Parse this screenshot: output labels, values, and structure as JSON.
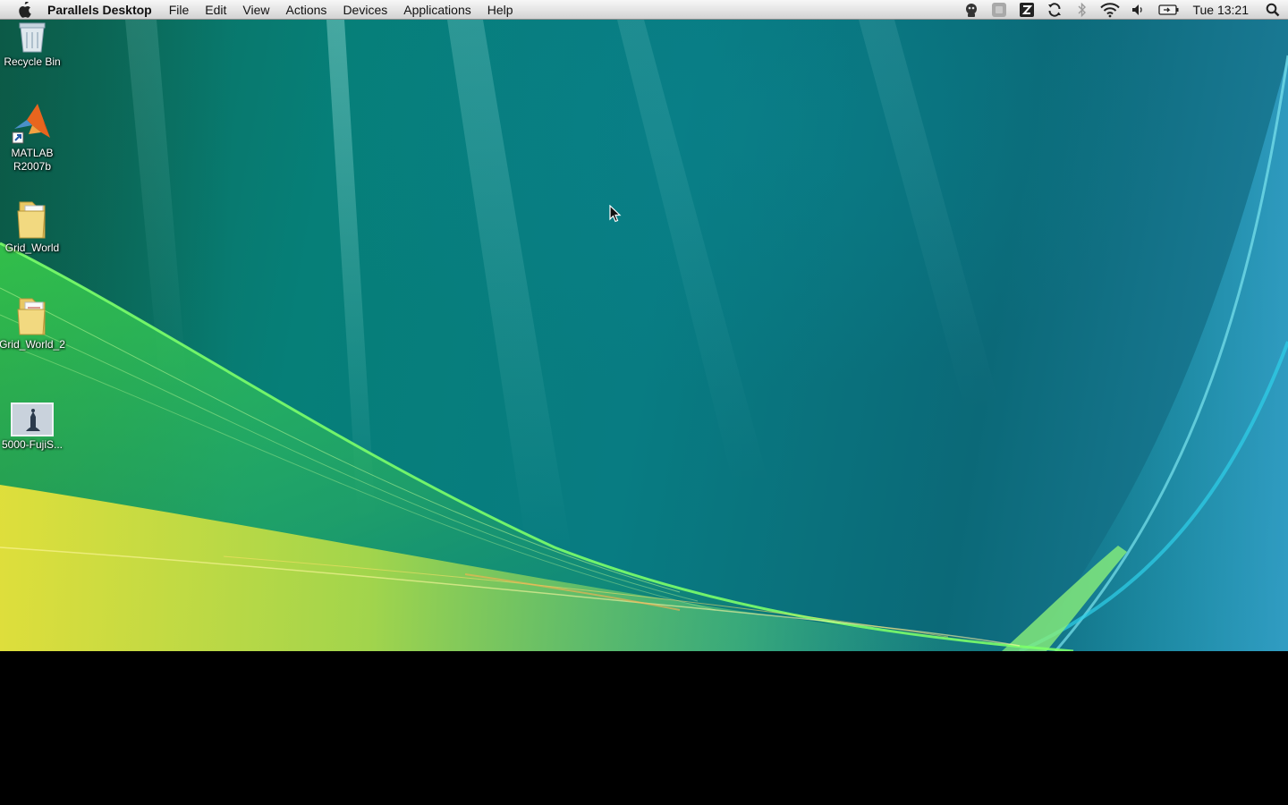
{
  "menubar": {
    "apple_icon": "apple-icon",
    "app_name": "Parallels Desktop",
    "menus": [
      "File",
      "Edit",
      "View",
      "Actions",
      "Devices",
      "Applications",
      "Help"
    ],
    "status_icons": [
      "parallels-icon",
      "coherence-icon",
      "app-switch-icon",
      "sync-icon",
      "bluetooth-icon",
      "wifi-icon",
      "volume-icon",
      "battery-icon"
    ],
    "clock": "Tue 13:21",
    "spotlight_icon": "search-icon"
  },
  "desktop": {
    "icons": [
      {
        "label": "Recycle Bin",
        "icon": "recycle-bin-icon"
      },
      {
        "label": "MATLAB R2007b",
        "icon": "matlab-icon"
      },
      {
        "label": "Grid_World",
        "icon": "folder-icon"
      },
      {
        "label": "Grid_World_2",
        "icon": "folder-icon"
      },
      {
        "label": "5000-FujiS...",
        "icon": "image-file-icon"
      }
    ]
  },
  "colors": {
    "wallpaper_teal": "#087c82",
    "wallpaper_green": "#3fe04a",
    "wallpaper_yellow": "#e8e23a",
    "menubar_bg": "#e4e4e4"
  }
}
